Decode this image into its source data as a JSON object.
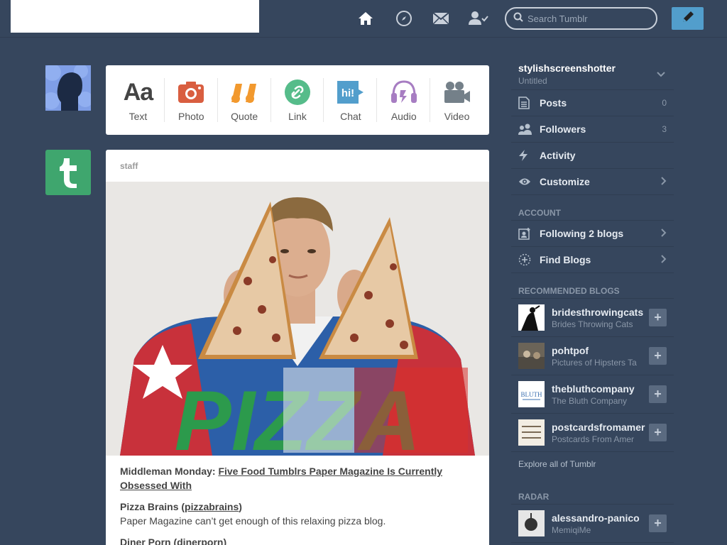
{
  "header": {
    "search_placeholder": "Search Tumblr",
    "icons": [
      "home-icon",
      "compass-icon",
      "mail-icon",
      "account-icon"
    ],
    "compose_icon": "pencil-icon",
    "accent": "#529ecc"
  },
  "post_types": [
    {
      "label": "Text",
      "icon": "text-icon",
      "color": "#444444"
    },
    {
      "label": "Photo",
      "icon": "camera-icon",
      "color": "#d95e40"
    },
    {
      "label": "Quote",
      "icon": "quote-icon",
      "color": "#f2992e"
    },
    {
      "label": "Link",
      "icon": "link-icon",
      "color": "#56bc8a"
    },
    {
      "label": "Chat",
      "icon": "chat-icon",
      "color": "#529ecc"
    },
    {
      "label": "Audio",
      "icon": "headphones-icon",
      "color": "#a77dc2"
    },
    {
      "label": "Video",
      "icon": "video-camera-icon",
      "color": "#748089"
    }
  ],
  "post": {
    "author": "staff",
    "image_text": "PIZZA",
    "lead_bold": "Middleman Monday: ",
    "lead_link": "Five Food Tumblrs Paper Magazine Is Currently Obsessed With",
    "item1_title": "Pizza Brains (",
    "item1_link": "pizzabrains",
    "item1_close": ")",
    "item1_desc": "Paper Magazine can’t get enough of this relaxing pizza blog.",
    "item2_title": "Diner Porn (",
    "item2_link": "dinerporn",
    "item2_close": ")"
  },
  "sidebar": {
    "blog_name": "stylishscreenshotter",
    "blog_title": "Untitled",
    "items": [
      {
        "label": "Posts",
        "count": "0",
        "icon": "posts-icon"
      },
      {
        "label": "Followers",
        "count": "3",
        "icon": "followers-icon"
      },
      {
        "label": "Activity",
        "count": "",
        "icon": "lightning-icon"
      },
      {
        "label": "Customize",
        "count": "",
        "icon": "eye-icon"
      }
    ],
    "account_heading": "ACCOUNT",
    "account_items": [
      {
        "label": "Following 2 blogs",
        "icon": "following-icon"
      },
      {
        "label": "Find Blogs",
        "icon": "find-blogs-icon"
      }
    ],
    "recommended_heading": "RECOMMENDED BLOGS",
    "recommended": [
      {
        "name": "bridesthrowingcats",
        "title": "Brides Throwing Cats"
      },
      {
        "name": "pohtpof",
        "title": "Pictures of Hipsters Ta"
      },
      {
        "name": "thebluthcompany",
        "title": "The Bluth Company"
      },
      {
        "name": "postcardsfromamer",
        "title": "Postcards From Amer"
      }
    ],
    "explore": "Explore all of Tumblr",
    "radar_heading": "RADAR",
    "radar": {
      "name": "alessandro-panico",
      "title": "MemiqiMe"
    }
  }
}
